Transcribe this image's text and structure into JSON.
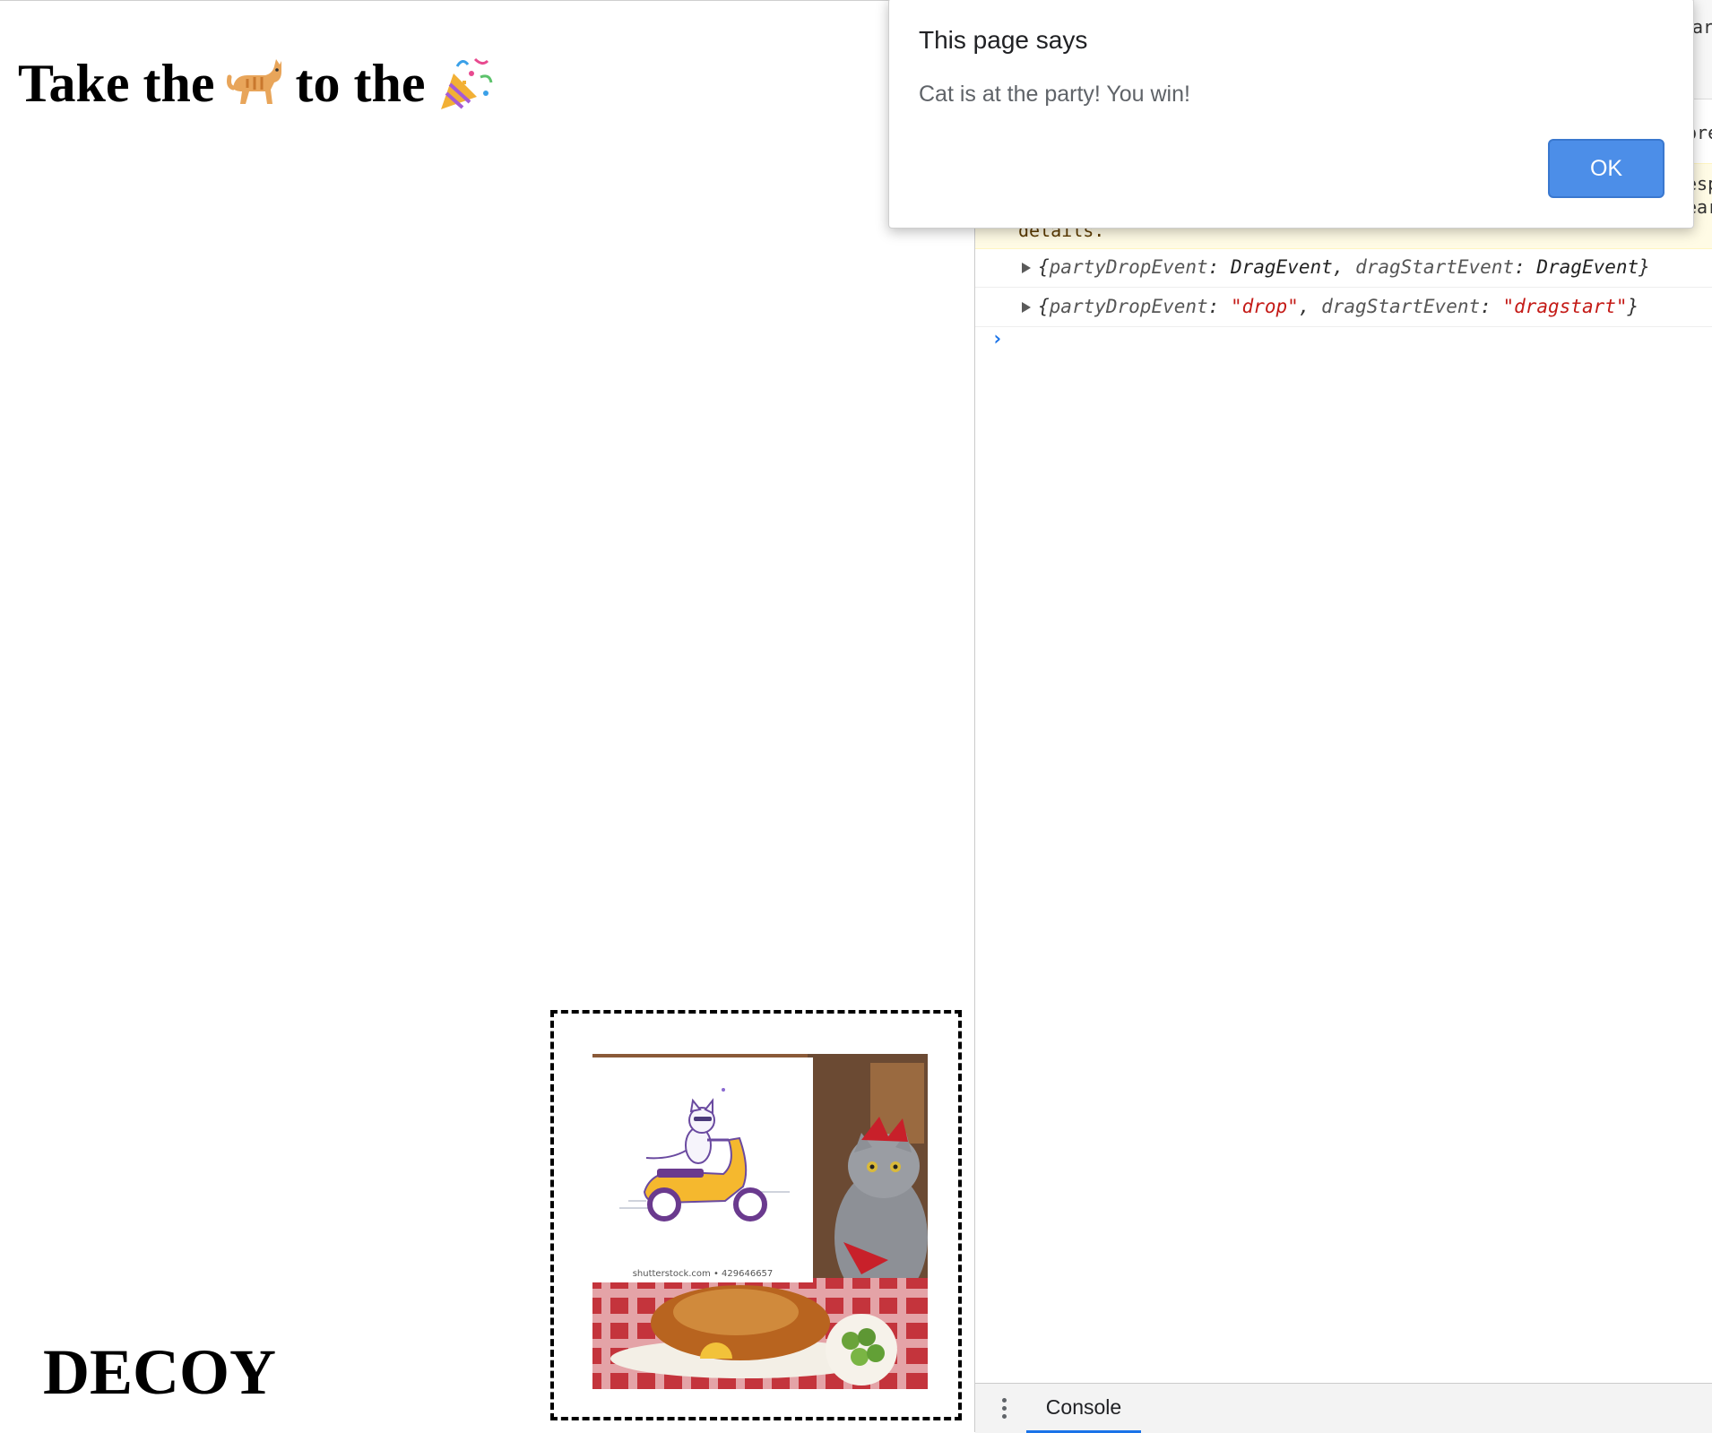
{
  "page": {
    "heading_take": "Take the",
    "heading_to": "to the",
    "decoy_label": "DECOY",
    "cat_image_caption": "shutterstock.com • 429646657",
    "icons": {
      "cat": "cat-emoji-icon",
      "party": "party-popper-emoji-icon"
    }
  },
  "devtools": {
    "top_fragments": [
      "ar",
      "pre",
      "esp",
      "ear"
    ],
    "warning_tail": "details.",
    "console_lines": [
      {
        "k1": "partyDropEvent",
        "v1": "DragEvent",
        "k2": "dragStartEvent",
        "v2": "DragEvent",
        "kind": "object"
      },
      {
        "k1": "partyDropEvent",
        "v1": "\"drop\"",
        "k2": "dragStartEvent",
        "v2": "\"dragstart\"",
        "kind": "string"
      }
    ],
    "prompt_symbol": "›",
    "drawer_tab": "Console"
  },
  "alert": {
    "title": "This page says",
    "message": "Cat is at the party! You win!",
    "ok_label": "OK"
  },
  "colors": {
    "ok_button": "#4c8ee8",
    "warning_bg": "#fffbe5",
    "string_red": "#c41a16",
    "accent_blue": "#1a73e8"
  }
}
